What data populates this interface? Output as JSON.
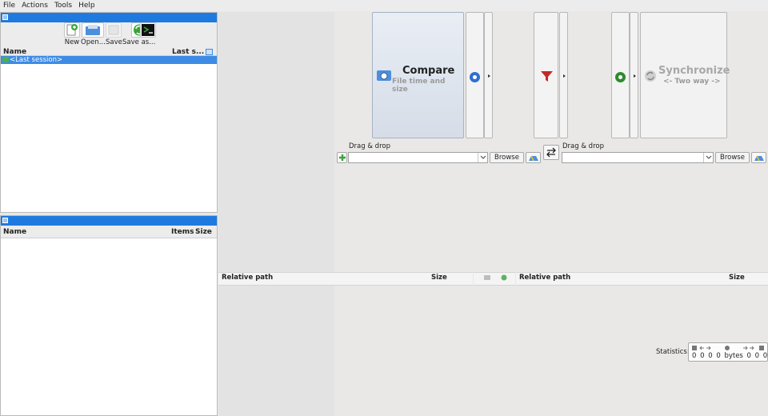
{
  "menu": [
    "File",
    "Actions",
    "Tools",
    "Help"
  ],
  "config_toolbar": {
    "new": "New",
    "open": "Open...",
    "save": "Save",
    "save_as": "Save as..."
  },
  "config_list": {
    "col_name": "Name",
    "col_last_sync": "Last s...",
    "session": "<Last session>"
  },
  "overview": {
    "col_name": "Name",
    "col_items": "Items",
    "col_size": "Size"
  },
  "compare": {
    "title": "Compare",
    "subtitle": "File time and size"
  },
  "synchronize": {
    "title": "Synchronize",
    "subtitle": "<- Two way ->"
  },
  "left_folder": {
    "label": "Drag & drop",
    "browse": "Browse",
    "path": ""
  },
  "right_folder": {
    "label": "Drag & drop",
    "browse": "Browse",
    "path": ""
  },
  "grid_left": {
    "col_path": "Relative path",
    "col_size": "Size"
  },
  "grid_right": {
    "col_path": "Relative path",
    "col_size": "Size"
  },
  "statistics": {
    "label": "Statistics:",
    "values": "0 0 0 0 bytes 0 0 0"
  },
  "colors": {
    "accent": "#1f7ae0",
    "selection": "#3d8be5",
    "filter_red": "#c62828",
    "gear_blue": "#2f6fd0",
    "gear_green": "#2e8b2e"
  }
}
